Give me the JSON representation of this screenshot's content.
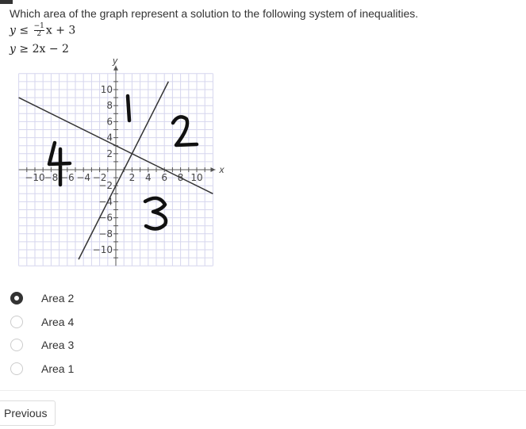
{
  "question": {
    "text": "Which area of the graph represent a solution to the following system of inequalities.",
    "inequality_1": {
      "lhs": "y",
      "op": "≤",
      "coef_num": "−1",
      "coef_den": "2",
      "rest": "x + 3"
    },
    "inequality_2": {
      "lhs": "y",
      "op": "≥",
      "rest": "2x − 2"
    }
  },
  "graph": {
    "x_axis_label": "x",
    "y_axis_label": "y",
    "x_ticks": [
      "−10",
      "−8",
      "−6",
      "−4",
      "−2",
      "2",
      "4",
      "6",
      "8",
      "10"
    ],
    "y_ticks": [
      "10",
      "8",
      "6",
      "4",
      "2",
      "−2",
      "−4",
      "−6",
      "−8",
      "−10"
    ],
    "lines": [
      "y = -1/2 x + 3",
      "y = 2x - 2"
    ],
    "area_labels": [
      "1",
      "2",
      "3",
      "4"
    ]
  },
  "options": [
    {
      "label": "Area 2",
      "selected": true
    },
    {
      "label": "Area 4",
      "selected": false
    },
    {
      "label": "Area 3",
      "selected": false
    },
    {
      "label": "Area 1",
      "selected": false
    }
  ],
  "nav": {
    "previous_label": "Previous"
  }
}
